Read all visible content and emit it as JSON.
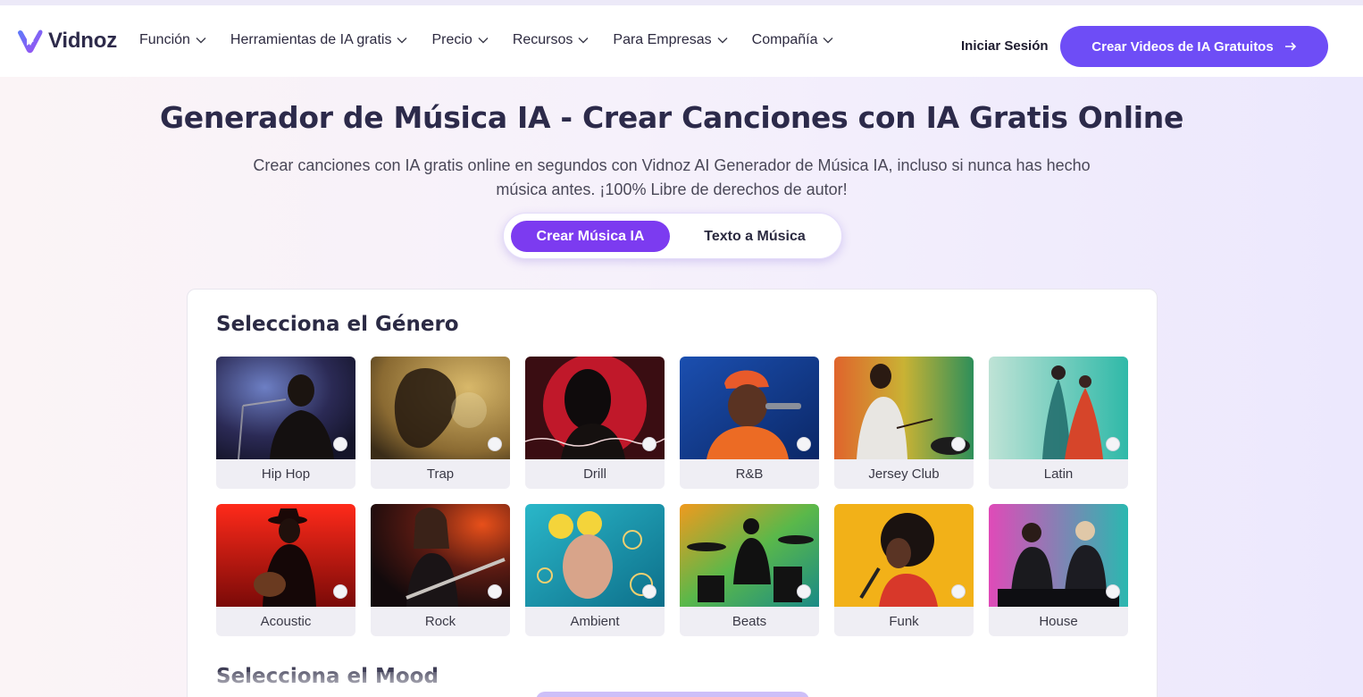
{
  "brand": {
    "name": "Vidnoz",
    "accent": "#6e4df6"
  },
  "nav": {
    "items": [
      {
        "label": "Función"
      },
      {
        "label": "Herramientas de IA gratis"
      },
      {
        "label": "Precio"
      },
      {
        "label": "Recursos"
      },
      {
        "label": "Para Empresas"
      },
      {
        "label": "Compañía"
      }
    ],
    "login_label": "Iniciar Sesión",
    "cta_label": "Crear Videos de IA Gratuitos"
  },
  "hero": {
    "title": "Generador de Música IA - Crear Canciones con IA Gratis Online",
    "subtitle_line1": "Crear canciones con IA gratis online en segundos con Vidnoz AI Generador de Música IA, incluso si nunca has hecho",
    "subtitle_line2": "música antes. ¡100% Libre de derechos de autor!"
  },
  "tabs": {
    "active_label": "Crear Música IA",
    "inactive_label": "Texto a Música"
  },
  "genre_section": {
    "title": "Selecciona el Género",
    "genres": [
      {
        "label": "Hip Hop"
      },
      {
        "label": "Trap"
      },
      {
        "label": "Drill"
      },
      {
        "label": "R&B"
      },
      {
        "label": "Jersey Club"
      },
      {
        "label": "Latin"
      },
      {
        "label": "Acoustic"
      },
      {
        "label": "Rock"
      },
      {
        "label": "Ambient"
      },
      {
        "label": "Beats"
      },
      {
        "label": "Funk"
      },
      {
        "label": "House"
      }
    ]
  },
  "mood_section": {
    "title": "Selecciona el Mood"
  }
}
